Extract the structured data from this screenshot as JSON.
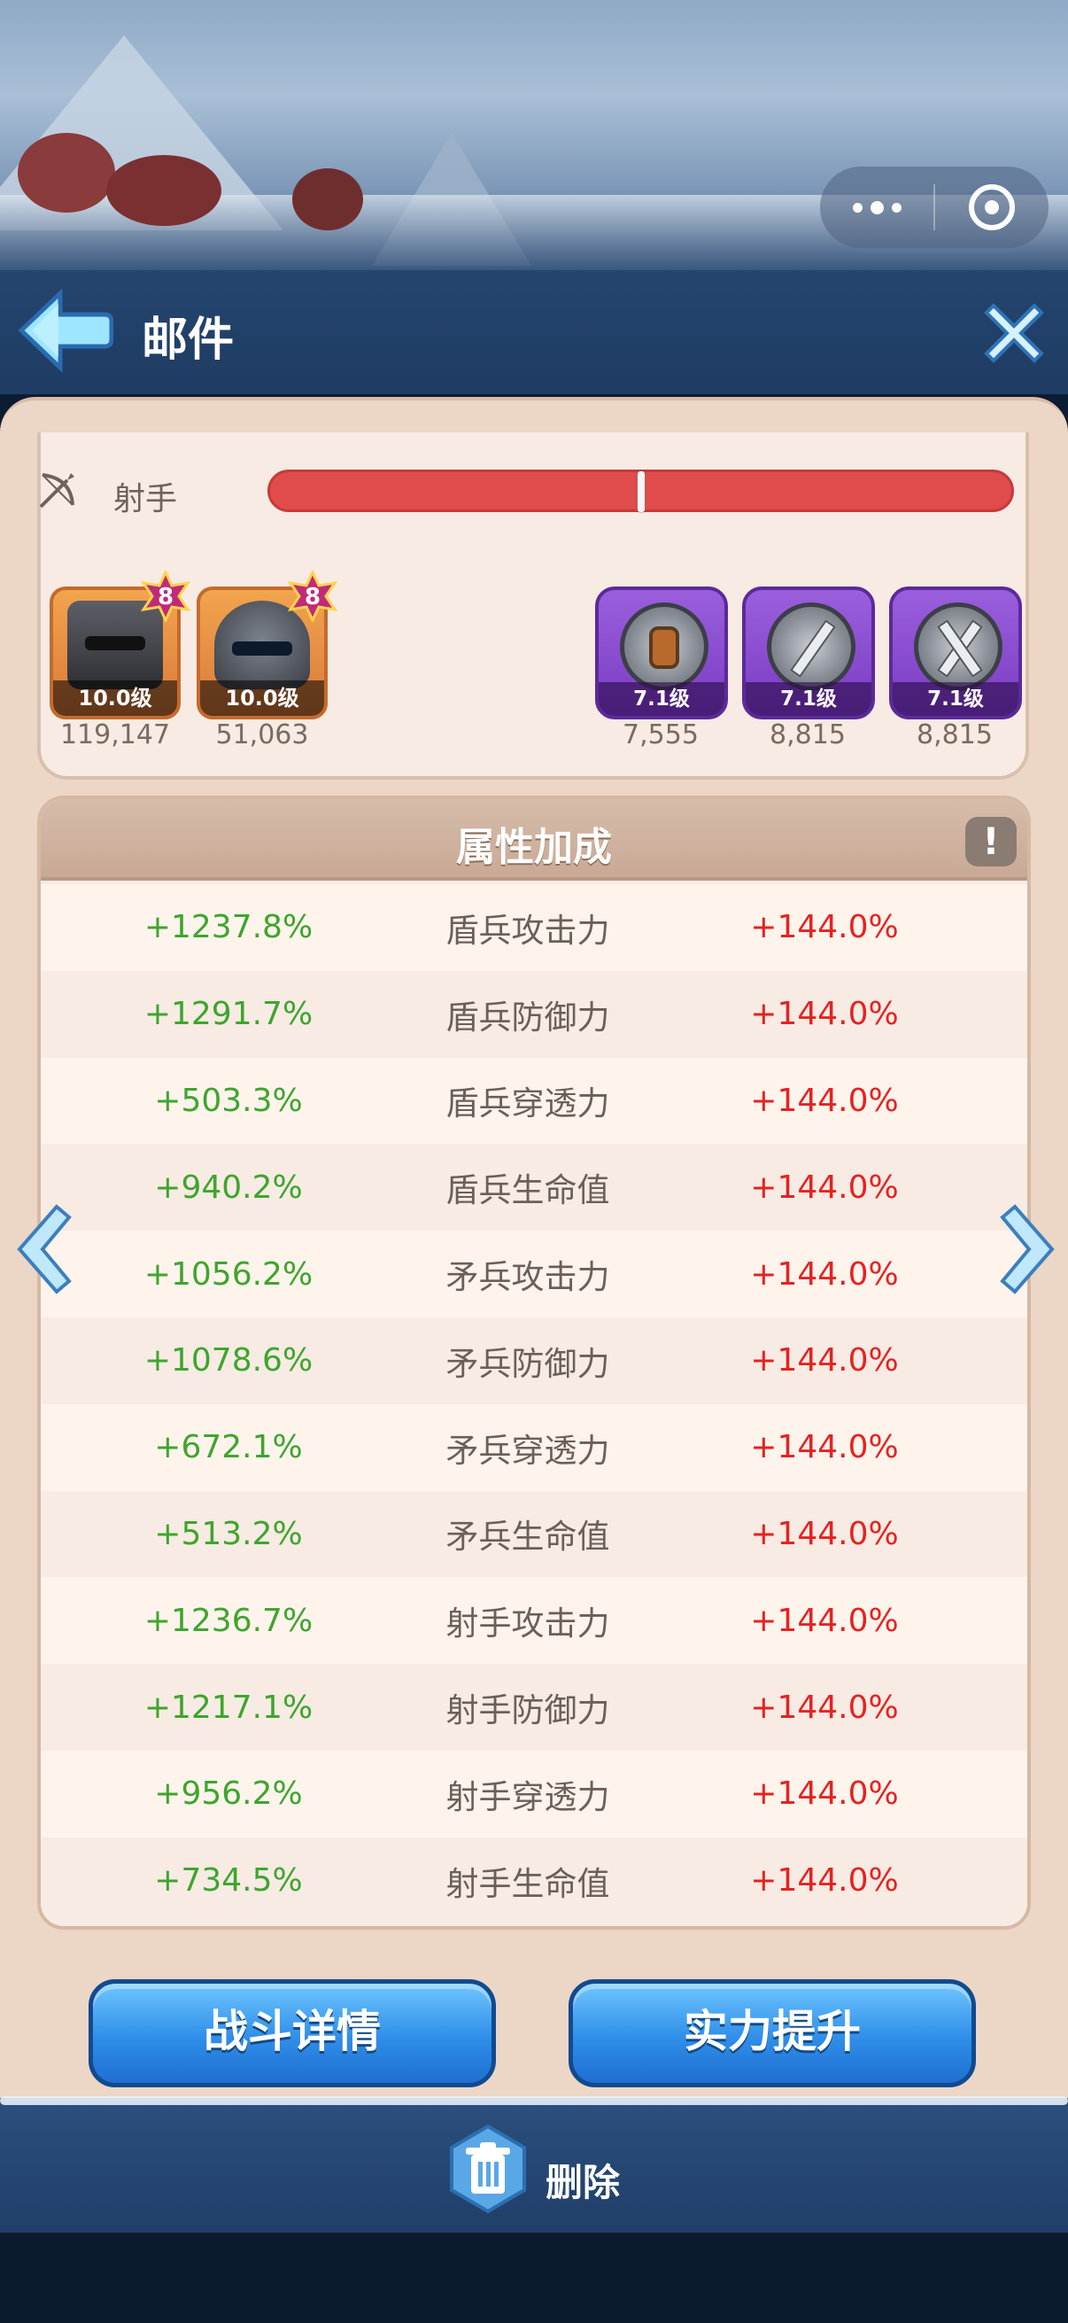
{
  "header": {
    "title": "邮件"
  },
  "unit_row": {
    "label": "射手",
    "hp_fraction": 0.5
  },
  "units": [
    {
      "badge": "8",
      "level": "10.0级",
      "value": "119,147"
    },
    {
      "badge": "8",
      "level": "10.0级",
      "value": "51,063"
    }
  ],
  "equips": [
    {
      "level": "7.1级",
      "value": "7,555"
    },
    {
      "level": "7.1级",
      "value": "8,815"
    },
    {
      "level": "7.1级",
      "value": "8,815"
    }
  ],
  "attributes": {
    "title": "属性加成",
    "info": "!",
    "rows": [
      {
        "left": "+1237.8%",
        "name": "盾兵攻击力",
        "right": "+144.0%"
      },
      {
        "left": "+1291.7%",
        "name": "盾兵防御力",
        "right": "+144.0%"
      },
      {
        "left": "+503.3%",
        "name": "盾兵穿透力",
        "right": "+144.0%"
      },
      {
        "left": "+940.2%",
        "name": "盾兵生命值",
        "right": "+144.0%"
      },
      {
        "left": "+1056.2%",
        "name": "矛兵攻击力",
        "right": "+144.0%"
      },
      {
        "left": "+1078.6%",
        "name": "矛兵防御力",
        "right": "+144.0%"
      },
      {
        "left": "+672.1%",
        "name": "矛兵穿透力",
        "right": "+144.0%"
      },
      {
        "left": "+513.2%",
        "name": "矛兵生命值",
        "right": "+144.0%"
      },
      {
        "left": "+1236.7%",
        "name": "射手攻击力",
        "right": "+144.0%"
      },
      {
        "left": "+1217.1%",
        "name": "射手防御力",
        "right": "+144.0%"
      },
      {
        "left": "+956.2%",
        "name": "射手穿透力",
        "right": "+144.0%"
      },
      {
        "left": "+734.5%",
        "name": "射手生命值",
        "right": "+144.0%"
      }
    ]
  },
  "buttons": {
    "battle_details": "战斗详情",
    "power_up": "实力提升"
  },
  "footer": {
    "delete_label": "删除"
  },
  "colors": {
    "positive": "#3ea52e",
    "bonus": "#e52222",
    "accent_blue": "#2f8ee8",
    "panel": "#ecd6c6"
  }
}
